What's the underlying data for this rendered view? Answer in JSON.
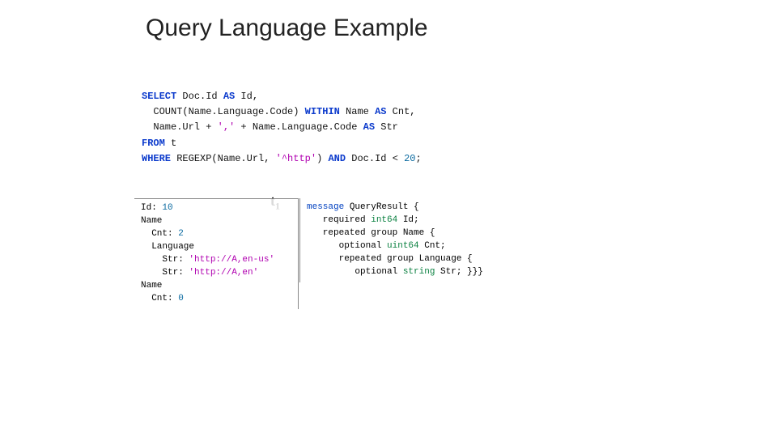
{
  "title": "Query Language Example",
  "t_label": "t",
  "t_sub": "1",
  "query": {
    "kw_select": "SELECT",
    "sel1": " Doc.Id ",
    "kw_as1": "AS",
    "as1": " Id,",
    "sel2a": "  COUNT(Name.Language.Code) ",
    "kw_within": "WITHIN",
    "sel2b": " Name ",
    "kw_as2": "AS",
    "as2": " Cnt,",
    "sel3a": "  Name.Url + ",
    "sel3str": "','",
    "sel3b": " + Name.Language.Code ",
    "kw_as3": "AS",
    "as3": " Str",
    "kw_from": "FROM",
    "from_t": " t",
    "kw_where": "WHERE",
    "reg_a": " REGEXP(Name.Url, ",
    "reg_str": "'^http'",
    "reg_b": ") ",
    "kw_and": "AND",
    "cmp_a": " Doc.Id < ",
    "cmp_num": "20",
    "cmp_end": ";"
  },
  "left": {
    "l1a": "Id: ",
    "l1b": "10",
    "l2": "Name",
    "l3a": "  Cnt: ",
    "l3b": "2",
    "l4": "  Language",
    "l5a": "    Str: ",
    "l5b": "'http://A,en-us'",
    "l6a": "    Str: ",
    "l6b": "'http://A,en'",
    "l7": "Name",
    "l8a": "  Cnt: ",
    "l8b": "0"
  },
  "right": {
    "r1a": "message",
    "r1b": " QueryResult {",
    "r2a": "   required ",
    "r2t": "int64",
    "r2b": " Id;",
    "r3": "   repeated group Name {",
    "r4a": "      optional ",
    "r4t": "uint64",
    "r4b": " Cnt;",
    "r5": "      repeated group Language {",
    "r6a": "         optional ",
    "r6t": "string",
    "r6b": " Str; }}}"
  }
}
